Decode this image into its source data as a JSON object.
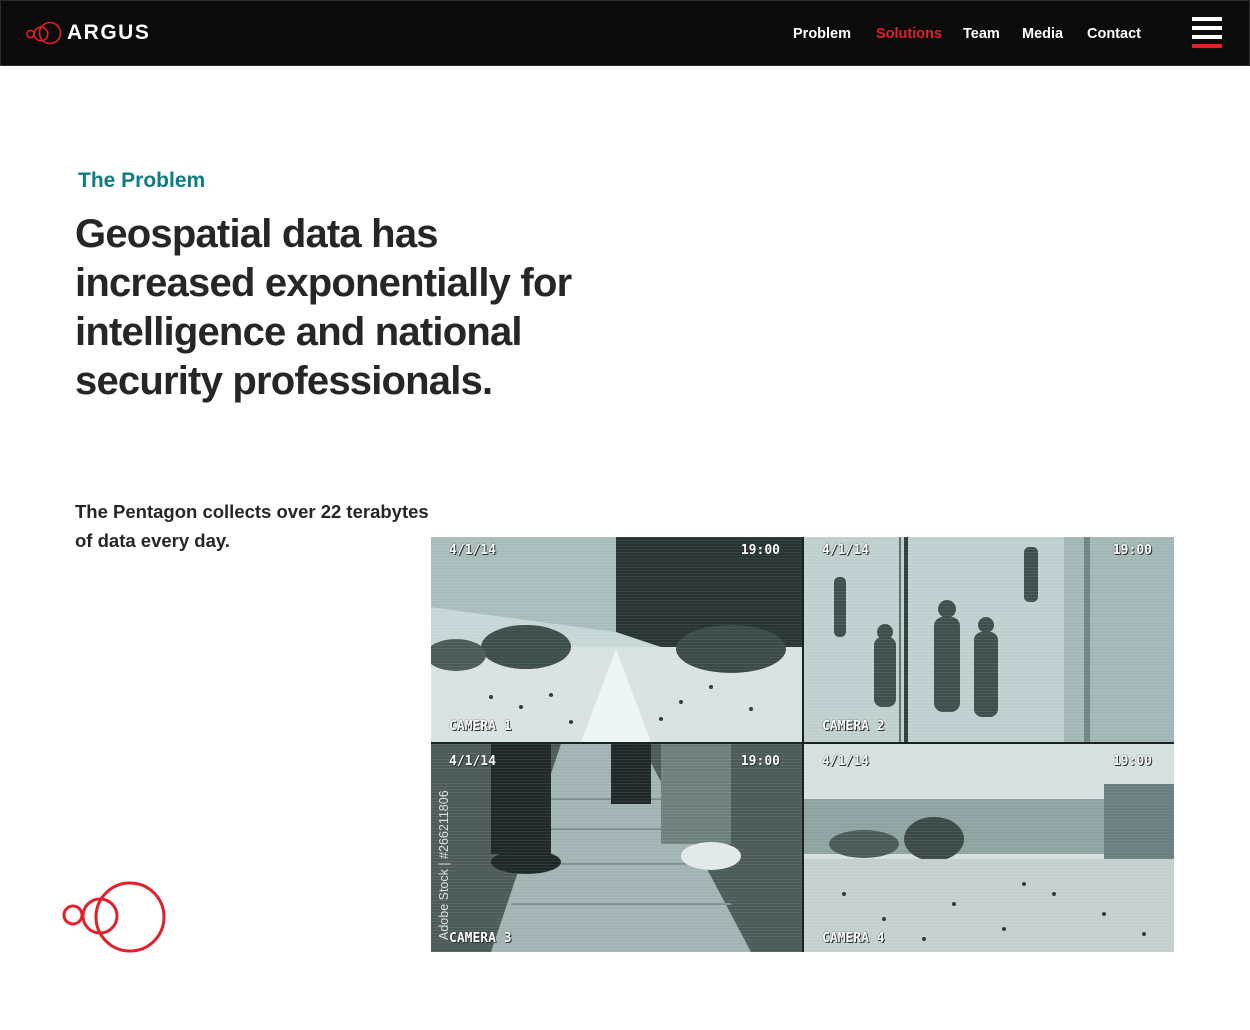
{
  "brand": {
    "name": "ARGUS",
    "accent": "#e3202a",
    "teal": "#0e7b86"
  },
  "nav": {
    "items": [
      {
        "label": "Problem",
        "active": false
      },
      {
        "label": "Solutions",
        "active": true
      },
      {
        "label": "Team",
        "active": false
      },
      {
        "label": "Media",
        "active": false
      },
      {
        "label": "Contact",
        "active": false
      }
    ],
    "menu_icon": "hamburger-icon"
  },
  "section": {
    "eyebrow": "The Problem",
    "headline": "Geospatial data has increased exponentially for intelligence and national security professionals.",
    "subtext": "The Pentagon collects over 22 terabytes of data every day."
  },
  "cameras": [
    {
      "date": "4/1/14",
      "time": "19:00",
      "label": "CAMERA 1"
    },
    {
      "date": "4/1/14",
      "time": "19:00",
      "label": "CAMERA 2"
    },
    {
      "date": "4/1/14",
      "time": "19:00",
      "label": "CAMERA 3"
    },
    {
      "date": "4/1/14",
      "time": "19:00",
      "label": "CAMERA 4"
    }
  ],
  "watermark": "Adobe Stock | #266211806"
}
